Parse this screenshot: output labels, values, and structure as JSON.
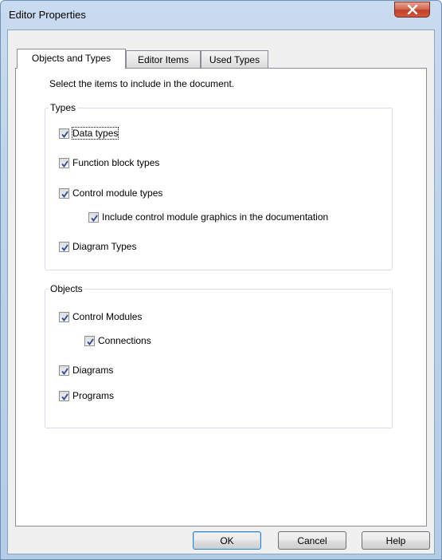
{
  "window": {
    "title": "Editor Properties"
  },
  "tabs": [
    {
      "label": "Objects and Types",
      "active": true
    },
    {
      "label": "Editor Items",
      "active": false
    },
    {
      "label": "Used Types",
      "active": false
    }
  ],
  "instruction": "Select the items to include in the document.",
  "types_group": {
    "legend": "Types",
    "items": [
      {
        "label": "Data types",
        "checked": true
      },
      {
        "label": "Function block types",
        "checked": true
      },
      {
        "label": "Control module types",
        "checked": true
      },
      {
        "label": "Include control module graphics in the documentation",
        "checked": true
      },
      {
        "label": "Diagram Types",
        "checked": true
      }
    ]
  },
  "objects_group": {
    "legend": "Objects",
    "items": [
      {
        "label": "Control Modules",
        "checked": true
      },
      {
        "label": "Connections",
        "checked": true
      },
      {
        "label": "Diagrams",
        "checked": true
      },
      {
        "label": "Programs",
        "checked": true
      }
    ]
  },
  "buttons": {
    "ok": "OK",
    "cancel": "Cancel",
    "help": "Help"
  },
  "icons": {
    "close": "close-icon",
    "check": "checkmark-icon"
  },
  "colors": {
    "check": "#2b4a9a",
    "titlebar": "#bcd2ea",
    "close": "#c0402a"
  }
}
